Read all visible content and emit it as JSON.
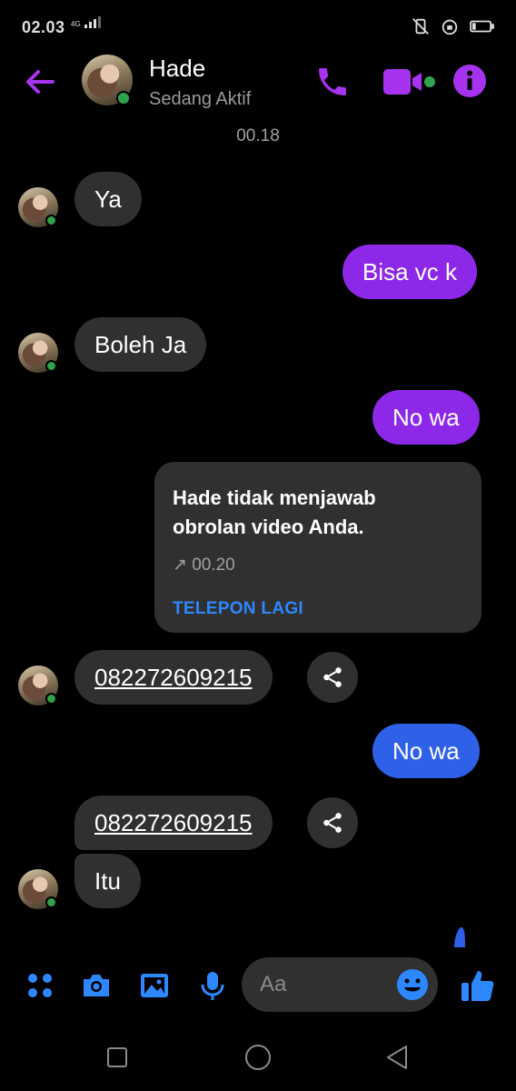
{
  "status_bar": {
    "time": "02.03",
    "network": "4G"
  },
  "header": {
    "name": "Hade",
    "status": "Sedang Aktif"
  },
  "timestamp": "00.18",
  "messages": [
    {
      "text": "Ya",
      "dir": "in"
    },
    {
      "text": "Bisa vc k",
      "dir": "out"
    },
    {
      "text": "Boleh Ja",
      "dir": "in"
    },
    {
      "text": "No wa",
      "dir": "out"
    },
    {
      "text": "082272609215",
      "dir": "in",
      "link": true
    },
    {
      "text": "No wa",
      "dir": "out"
    },
    {
      "text": "082272609215",
      "dir": "in",
      "link": true
    },
    {
      "text": "Itu",
      "dir": "in"
    }
  ],
  "call_card": {
    "title": "Hade tidak menjawab obrolan video Anda.",
    "time": "↗ 00.20",
    "action": "TELEPON LAGI"
  },
  "composer": {
    "placeholder": "Aa"
  },
  "icons": {
    "back": "arrow-left-icon",
    "call": "phone-icon",
    "video": "video-camera-icon",
    "info": "info-icon",
    "share": "share-icon",
    "apps": "four-dots-icon",
    "camera": "camera-icon",
    "gallery": "image-icon",
    "mic": "microphone-icon",
    "emoji": "emoji-icon",
    "like": "thumbs-up-icon"
  },
  "colors": {
    "accent_purple": "#8d28e8",
    "accent_blue": "#2f60e8",
    "link_blue": "#2d88ff",
    "online": "#31a24c"
  }
}
